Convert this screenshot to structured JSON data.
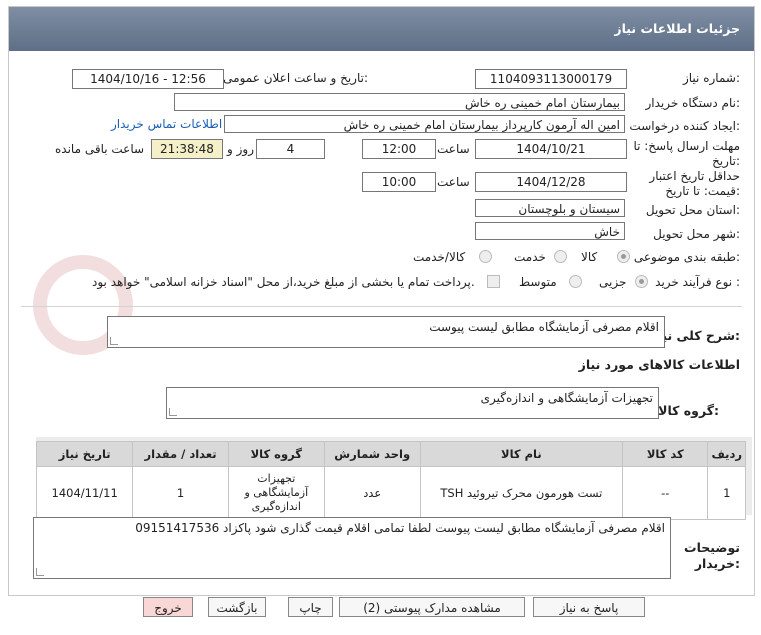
{
  "header": {
    "title": "جزئیات اطلاعات نیاز"
  },
  "fields": {
    "need_number_label": "شماره نیاز:",
    "need_number": "1104093113000179",
    "announce_label": "تاریخ و ساعت اعلان عمومی:",
    "announce_value": "1404/10/16 - 12:56",
    "buyer_org_label": "نام دستگاه خریدار:",
    "buyer_org": "بیمارستان امام خمینی  ره  خاش",
    "requester_label": "ایجاد کننده درخواست:",
    "requester": "امین اله آرمون کارپرداز بیمارستان امام خمینی  ره  خاش",
    "contact_link": "اطلاعات تماس خریدار",
    "deadline_label": "مهلت ارسال پاسخ: تا تاریخ:",
    "deadline_date": "1404/10/21",
    "time_label": "ساعت",
    "deadline_time": "12:00",
    "days_value": "4",
    "days_label": "روز و",
    "remaining_time": "21:38:48",
    "remaining_label": "ساعت باقی مانده",
    "validity_label": "حداقل تاریخ اعتبار قیمت: تا تاریخ:",
    "validity_date": "1404/12/28",
    "validity_time": "10:00",
    "province_label": "استان محل تحویل:",
    "province": "سیستان و بلوچستان",
    "city_label": "شهر محل تحویل:",
    "city": "خاش",
    "category_label": "طبقه بندی موضوعی:",
    "category_options": [
      "کالا",
      "خدمت",
      "کالا/خدمت"
    ],
    "process_label": "نوع فرآیند خرید :",
    "process_options": [
      "جزیی",
      "متوسط"
    ],
    "payment_note": "پرداخت تمام یا بخشی از مبلغ خرید،از محل \"اسناد خزانه اسلامی\" خواهد بود."
  },
  "description": {
    "label": "شرح کلی نیاز:",
    "value": "اقلام مصرفی آزمایشگاه مطابق لیست پیوست"
  },
  "goods_section": {
    "title": "اطلاعات کالاهای مورد نیاز",
    "group_label": "گروه کالا:",
    "group_value": "تجهیزات آزمایشگاهی و اندازه‌گیری"
  },
  "table": {
    "headers": [
      "ردیف",
      "کد کالا",
      "نام کالا",
      "واحد شمارش",
      "گروه کالا",
      "تعداد / مقدار",
      "تاریخ نیاز"
    ],
    "rows": [
      {
        "index": "1",
        "code": "--",
        "name": "تست هورمون محرک تیروئید TSH",
        "unit": "عدد",
        "group": "تجهیزات آزمایشگاهی و اندازه‌گیری",
        "qty": "1",
        "date": "1404/11/11"
      }
    ]
  },
  "buyer_notes": {
    "label": "توضیحات خریدار:",
    "value": "اقلام مصرفی آزمایشگاه مطابق لیست پیوست لطفا تمامی اقلام قیمت گذاری شود  پاکزاد 09151417536"
  },
  "buttons": {
    "reply": "پاسخ به نیاز",
    "attachments": "مشاهده مدارک پیوستی (2)",
    "print": "چاپ",
    "back": "بازگشت",
    "exit": "خروج"
  },
  "colors": {
    "header": "#6b7b93",
    "link": "#1a5fb4",
    "exit_button": "#f9d7d7"
  }
}
